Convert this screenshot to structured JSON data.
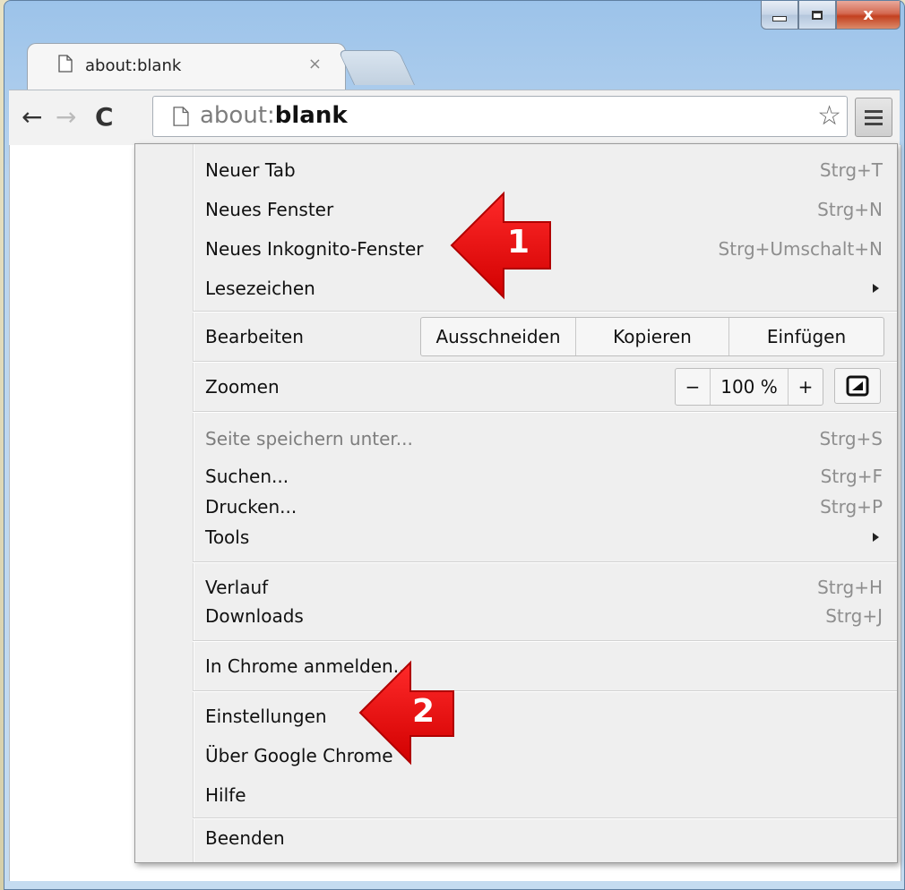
{
  "window": {
    "close_glyph": "x"
  },
  "tab": {
    "title": "about:blank",
    "close_glyph": "×"
  },
  "toolbar": {
    "back_glyph": "←",
    "forward_glyph": "→",
    "reload_glyph": "C",
    "url_scheme": "about:",
    "url_host": "blank",
    "star_glyph": "☆"
  },
  "menu": {
    "new_tab": {
      "label": "Neuer Tab",
      "shortcut": "Strg+T"
    },
    "new_window": {
      "label": "Neues Fenster",
      "shortcut": "Strg+N"
    },
    "incognito": {
      "label": "Neues Inkognito-Fenster",
      "shortcut": "Strg+Umschalt+N"
    },
    "bookmarks": {
      "label": "Lesezeichen"
    },
    "edit": {
      "label": "Bearbeiten",
      "cut": "Ausschneiden",
      "copy": "Kopieren",
      "paste": "Einfügen"
    },
    "zoom": {
      "label": "Zoomen",
      "minus": "−",
      "value": "100 %",
      "plus": "+"
    },
    "save_page": {
      "label": "Seite speichern unter...",
      "shortcut": "Strg+S"
    },
    "find": {
      "label": "Suchen...",
      "shortcut": "Strg+F"
    },
    "print": {
      "label": "Drucken...",
      "shortcut": "Strg+P"
    },
    "tools": {
      "label": "Tools"
    },
    "history": {
      "label": "Verlauf",
      "shortcut": "Strg+H"
    },
    "downloads": {
      "label": "Downloads",
      "shortcut": "Strg+J"
    },
    "signin": {
      "label": "In Chrome anmelden..."
    },
    "settings": {
      "label": "Einstellungen"
    },
    "about": {
      "label": "Über Google Chrome"
    },
    "help": {
      "label": "Hilfe"
    },
    "exit": {
      "label": "Beenden"
    }
  },
  "annotations": {
    "arrow1": "1",
    "arrow2": "2",
    "color": "#ee0000"
  }
}
